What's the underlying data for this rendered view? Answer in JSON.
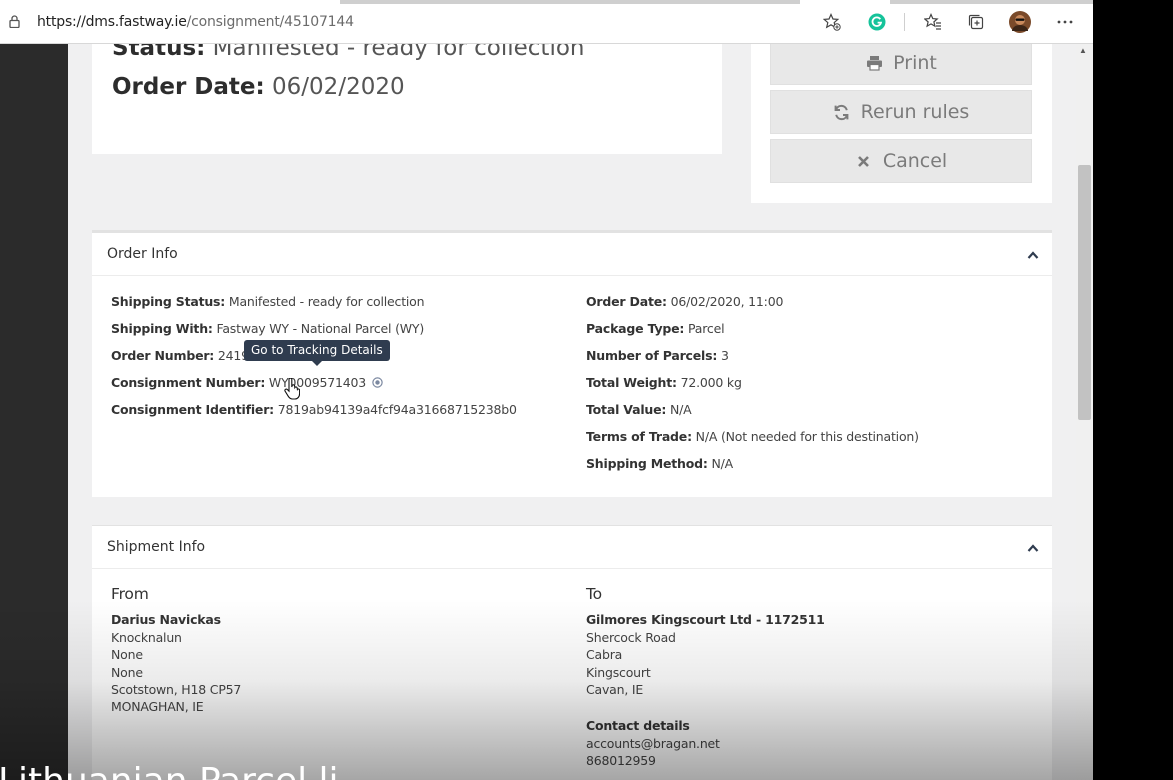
{
  "browser": {
    "url_host": "https://dms.fastway.ie",
    "url_path": "/consignment/45107144"
  },
  "header": {
    "status_label": "Status:",
    "status_value": "Manifested - ready for collection",
    "order_date_label": "Order Date:",
    "order_date_value": "06/02/2020"
  },
  "actions": {
    "print": "Print",
    "rerun": "Rerun rules",
    "cancel": "Cancel"
  },
  "order_info": {
    "title": "Order Info",
    "left": [
      {
        "label": "Shipping Status:",
        "value": "Manifested - ready for collection"
      },
      {
        "label": "Shipping With:",
        "value": "Fastway WY - National Parcel (WY)"
      },
      {
        "label": "Order Number:",
        "value": "24198"
      },
      {
        "label": "Consignment Number:",
        "value": "WY0009571403"
      },
      {
        "label": "Consignment Identifier:",
        "value": "7819ab94139a4fcf94a31668715238b0"
      }
    ],
    "right": [
      {
        "label": "Order Date:",
        "value": "06/02/2020, 11:00"
      },
      {
        "label": "Package Type:",
        "value": "Parcel"
      },
      {
        "label": "Number of Parcels:",
        "value": "3"
      },
      {
        "label": "Total Weight:",
        "value": "72.000 kg"
      },
      {
        "label": "Total Value:",
        "value": "N/A"
      },
      {
        "label": "Terms of Trade:",
        "value": "N/A (Not needed for this destination)"
      },
      {
        "label": "Shipping Method:",
        "value": "N/A"
      }
    ],
    "tooltip": "Go to Tracking Details"
  },
  "shipment_info": {
    "title": "Shipment Info",
    "from": {
      "heading": "From",
      "name": "Darius Navickas",
      "lines": [
        "Knocknalun",
        "None",
        "None",
        "Scotstown, H18 CP57",
        "MONAGHAN, IE"
      ]
    },
    "to": {
      "heading": "To",
      "name": "Gilmores Kingscourt Ltd - 1172511",
      "lines": [
        "Shercock Road",
        "Cabra",
        "Kingscourt",
        "Cavan, IE"
      ],
      "contact_heading": "Contact details",
      "contact_lines": [
        "accounts@bragan.net",
        "868012959"
      ]
    }
  },
  "overlay_caption": "Lithuanian Parcel li",
  "colors": {
    "grammarly": "#15c39a",
    "tooltip_bg": "#2f3c4f",
    "button_bg": "#e8e8e8"
  }
}
